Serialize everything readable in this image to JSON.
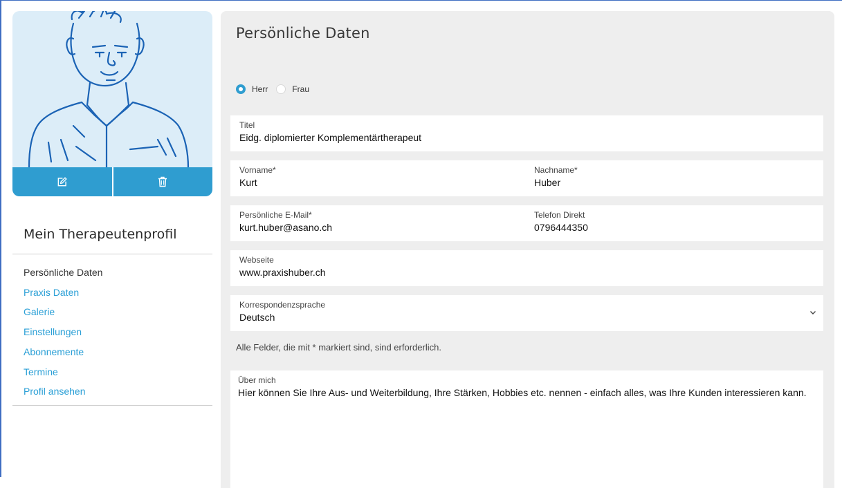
{
  "sidebar": {
    "title": "Mein Therapeutenprofil",
    "items": [
      {
        "label": "Persönliche Daten",
        "active": true
      },
      {
        "label": "Praxis Daten",
        "active": false
      },
      {
        "label": "Galerie",
        "active": false
      },
      {
        "label": "Einstellungen",
        "active": false
      },
      {
        "label": "Abonnemente",
        "active": false
      },
      {
        "label": "Termine",
        "active": false
      },
      {
        "label": "Profil ansehen",
        "active": false
      }
    ],
    "avatar_actions": [
      {
        "icon": "edit-icon"
      },
      {
        "icon": "trash-icon"
      }
    ]
  },
  "main": {
    "title": "Persönliche Daten",
    "gender": {
      "selected": "Herr",
      "options": [
        "Herr",
        "Frau"
      ]
    },
    "fields": {
      "titel": {
        "label": "Titel",
        "value": "Eidg. diplomierter Komplementärtherapeut"
      },
      "vorname": {
        "label": "Vorname*",
        "value": "Kurt"
      },
      "nachname": {
        "label": "Nachname*",
        "value": "Huber"
      },
      "email": {
        "label": "Persönliche E-Mail*",
        "value": "kurt.huber@asano.ch"
      },
      "telefon": {
        "label": "Telefon Direkt",
        "value": "0796444350"
      },
      "webseite": {
        "label": "Webseite",
        "value": "www.praxishuber.ch"
      },
      "sprache": {
        "label": "Korrespondenzsprache",
        "value": "Deutsch"
      }
    },
    "required_note": "Alle Felder, die mit * markiert sind, sind erforderlich.",
    "about": {
      "label": "Über mich",
      "value": "Hier können Sie Ihre Aus- und Weiterbildung, Ihre Stärken, Hobbies etc. nennen - einfach alles, was Ihre Kunden interessieren kann."
    }
  },
  "colors": {
    "accent": "#2f9dd0",
    "avatar_bg": "#dcedf8",
    "panel_bg": "#eeeeee",
    "link": "#2a9fd6"
  }
}
